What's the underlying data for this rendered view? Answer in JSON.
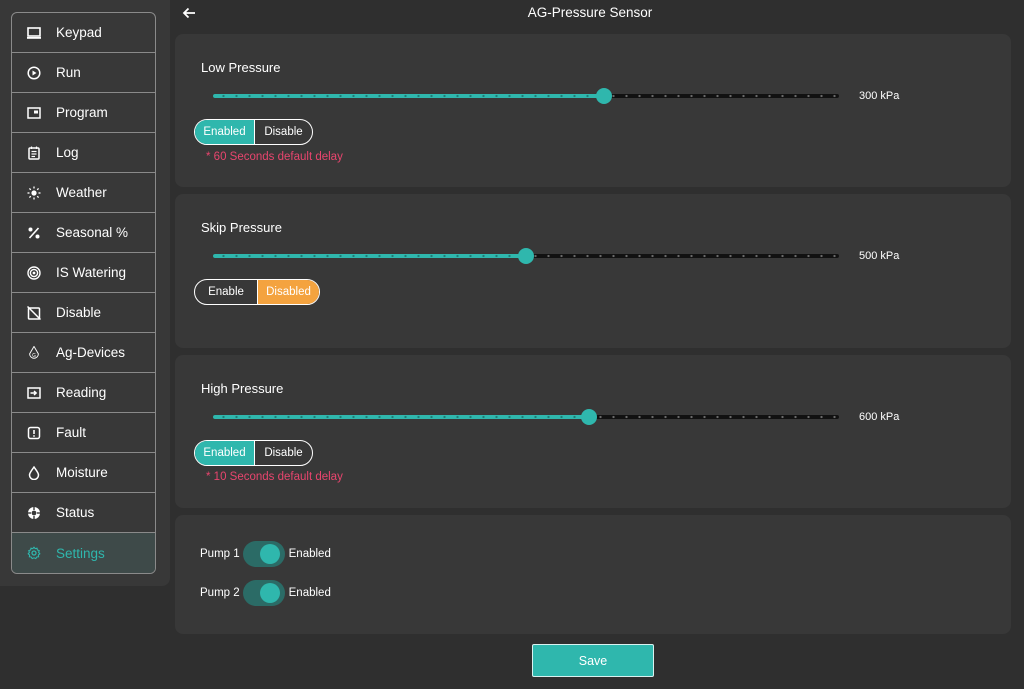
{
  "page": {
    "title": "AG-Pressure Sensor"
  },
  "sidebar": {
    "items": [
      {
        "label": "Keypad",
        "icon": "keyboard-icon"
      },
      {
        "label": "Run",
        "icon": "play-circle-icon"
      },
      {
        "label": "Program",
        "icon": "program-icon"
      },
      {
        "label": "Log",
        "icon": "log-icon"
      },
      {
        "label": "Weather",
        "icon": "sun-icon"
      },
      {
        "label": "Seasonal %",
        "icon": "percent-icon"
      },
      {
        "label": "IS Watering",
        "icon": "watering-icon"
      },
      {
        "label": "Disable",
        "icon": "disable-icon"
      },
      {
        "label": "Ag-Devices",
        "icon": "ag-devices-icon"
      },
      {
        "label": "Reading",
        "icon": "reading-icon"
      },
      {
        "label": "Fault",
        "icon": "fault-icon"
      },
      {
        "label": "Moisture",
        "icon": "droplet-icon"
      },
      {
        "label": "Status",
        "icon": "status-icon"
      },
      {
        "label": "Settings",
        "icon": "gear-icon",
        "active": true
      }
    ]
  },
  "low_pressure": {
    "title": "Low Pressure",
    "value_label": "300 kPa",
    "level": 0.625,
    "toggle": {
      "option_a": "Enabled",
      "option_b": "Disable",
      "selected": "Enabled"
    },
    "note": "* 60 Seconds default delay"
  },
  "skip_pressure": {
    "title": "Skip Pressure",
    "value_label": "500 kPa",
    "level": 0.5,
    "toggle": {
      "option_a": "Enable",
      "option_b": "Disabled",
      "selected": "Disabled"
    }
  },
  "high_pressure": {
    "title": "High Pressure",
    "value_label": "600 kPa",
    "level": 0.6,
    "toggle": {
      "option_a": "Enabled",
      "option_b": "Disable",
      "selected": "Enabled"
    },
    "note": "* 10 Seconds default delay"
  },
  "pumps": [
    {
      "label": "Pump 1",
      "state": "Enabled",
      "on": true
    },
    {
      "label": "Pump 2",
      "state": "Enabled",
      "on": true
    }
  ],
  "save_label": "Save",
  "colors": {
    "accent": "#2fb7ad",
    "warning": "#f4a33f",
    "note": "#e8456e",
    "background": "#2f2f2f",
    "panel": "#383838"
  }
}
